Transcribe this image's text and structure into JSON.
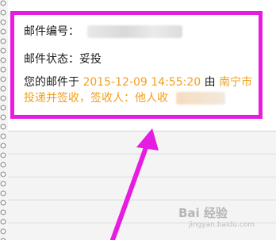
{
  "card": {
    "mail_number_label": "邮件编号：",
    "mail_status_label": "邮件状态：妥投",
    "detail_prefix": "您的邮件于 ",
    "detail_datetime": "2015-12-09 14:55:20",
    "detail_by": " 由 ",
    "detail_city": "南宁市",
    "detail_line2": "投递并签收，签收人：他人收 ",
    "accent_color": "#f2a01e",
    "highlight_color": "#e61ce0"
  },
  "watermark": {
    "logo_text": "Bai 经验",
    "url_text": "jingyan.baidu.com"
  }
}
